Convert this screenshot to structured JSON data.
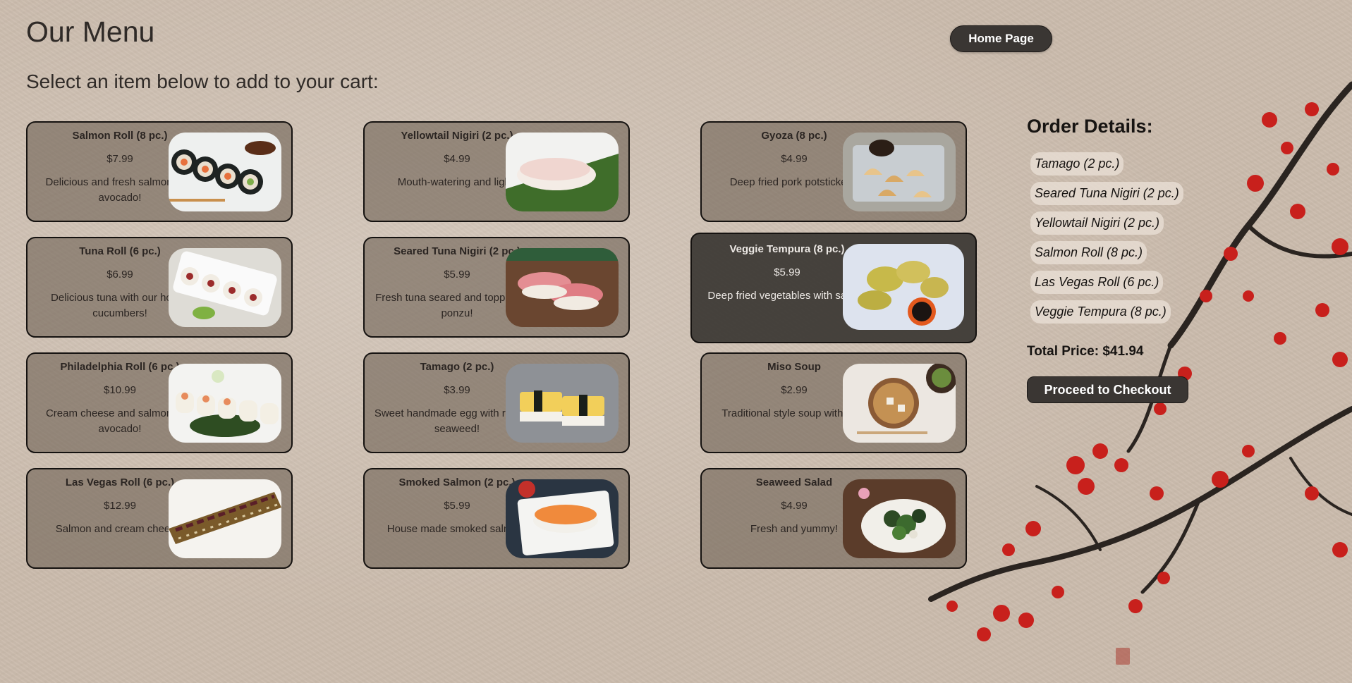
{
  "header": {
    "title": "Our Menu",
    "home_label": "Home Page",
    "subtitle": "Select an item below to add to your cart:"
  },
  "menu": [
    {
      "name": "Salmon Roll (8 pc.)",
      "price": "$7.99",
      "desc": "Delicious and fresh salmon with avocado!",
      "image": "salmon-roll-image"
    },
    {
      "name": "Yellowtail Nigiri (2 pc.)",
      "price": "$4.99",
      "desc": "Mouth-watering and light!",
      "image": "yellowtail-nigiri-image"
    },
    {
      "name": "Gyoza (8 pc.)",
      "price": "$4.99",
      "desc": "Deep fried pork potstickers!",
      "image": "gyoza-image"
    },
    {
      "name": "Tuna Roll (6 pc.)",
      "price": "$6.99",
      "desc": "Delicious tuna with our house cucumbers!",
      "image": "tuna-roll-image"
    },
    {
      "name": "Seared Tuna Nigiri (2 pc.)",
      "price": "$5.99",
      "desc": "Fresh tuna seared and topped with ponzu!",
      "image": "seared-tuna-image"
    },
    {
      "name": "Veggie Tempura (8 pc.)",
      "price": "$5.99",
      "desc": "Deep fried vegetables with sauce!",
      "image": "veggie-tempura-image",
      "state": "hovered"
    },
    {
      "name": "Philadelphia Roll (6 pc.)",
      "price": "$10.99",
      "desc": "Cream cheese and salmon with avocado!",
      "image": "philadelphia-roll-image"
    },
    {
      "name": "Tamago (2 pc.)",
      "price": "$3.99",
      "desc": "Sweet handmade egg with rice and seaweed!",
      "image": "tamago-image"
    },
    {
      "name": "Miso Soup",
      "price": "$2.99",
      "desc": "Traditional style soup with tofu!",
      "image": "miso-soup-image"
    },
    {
      "name": "Las Vegas Roll (6 pc.)",
      "price": "$12.99",
      "desc": "Salmon and cream cheese!",
      "image": "las-vegas-roll-image"
    },
    {
      "name": "Smoked Salmon (2 pc.)",
      "price": "$5.99",
      "desc": "House made smoked salmon!",
      "image": "smoked-salmon-image"
    },
    {
      "name": "Seaweed Salad",
      "price": "$4.99",
      "desc": "Fresh and yummy!",
      "image": "seaweed-salad-image"
    }
  ],
  "order": {
    "title": "Order Details:",
    "items": [
      "Tamago (2 pc.)",
      "Seared Tuna Nigiri (2 pc.)",
      "Yellowtail Nigiri (2 pc.)",
      "Salmon Roll (8 pc.)",
      "Las Vegas Roll (6 pc.)",
      "Veggie Tempura (8 pc.)"
    ],
    "total": "Total Price: $41.94",
    "checkout_label": "Proceed to Checkout"
  },
  "colors": {
    "background": "#cbbcad",
    "card": "#706256",
    "card_hover": "#3a3632",
    "button": "#3a3633",
    "blossom": "#c8201c"
  }
}
